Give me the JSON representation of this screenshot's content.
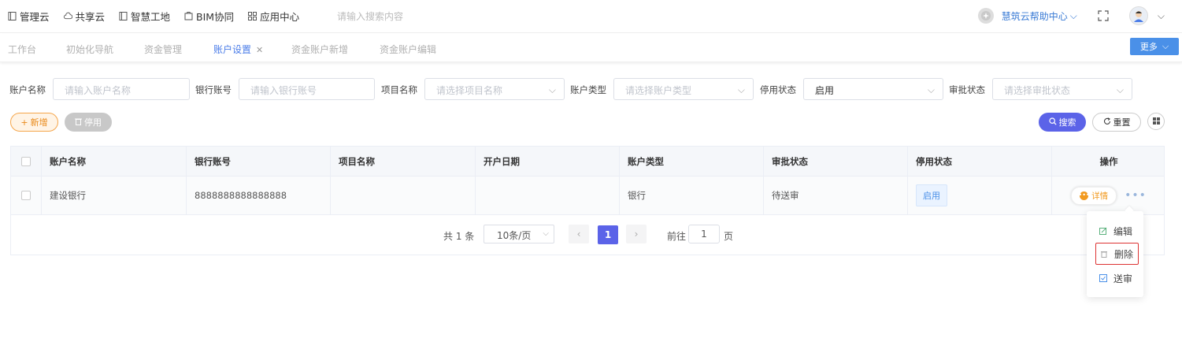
{
  "topnav": {
    "items": [
      {
        "label": "管理云",
        "icon": "book-icon"
      },
      {
        "label": "共享云",
        "icon": "cloud-icon"
      },
      {
        "label": "智慧工地",
        "icon": "book-icon"
      },
      {
        "label": "BIM协同",
        "icon": "box-icon"
      },
      {
        "label": "应用中心",
        "icon": "grid-icon"
      }
    ],
    "search_placeholder": "请输入搜索内容",
    "help_label": "慧筑云帮助中心"
  },
  "tabs": {
    "items": [
      "工作台",
      "初始化导航",
      "资金管理",
      "账户设置",
      "资金账户新增",
      "资金账户编辑"
    ],
    "active": "账户设置",
    "more_label": "更多"
  },
  "filters": {
    "account_name": {
      "label": "账户名称",
      "placeholder": "请输入账户名称"
    },
    "bank_account": {
      "label": "银行账号",
      "placeholder": "请输入银行账号"
    },
    "project_name": {
      "label": "项目名称",
      "placeholder": "请选择项目名称"
    },
    "account_type": {
      "label": "账户类型",
      "placeholder": "请选择账户类型"
    },
    "disable_status": {
      "label": "停用状态",
      "value": "启用"
    },
    "approval_status": {
      "label": "审批状态",
      "placeholder": "请选择审批状态"
    }
  },
  "actions": {
    "add_label": "新增",
    "disable_label": "停用",
    "search_label": "搜索",
    "reset_label": "重置"
  },
  "table": {
    "columns": [
      "账户名称",
      "银行账号",
      "项目名称",
      "开户日期",
      "账户类型",
      "审批状态",
      "停用状态",
      "操作"
    ],
    "rows": [
      {
        "account_name": "建设银行",
        "bank_account": "8888888888888888",
        "project_name": "",
        "open_date": "",
        "account_type": "银行",
        "approval_status": "待送审",
        "disable_status": "启用",
        "detail_label": "详情"
      }
    ]
  },
  "pagination": {
    "total": "共 1 条",
    "page_size": "10条/页",
    "current": "1",
    "goto_label": "前往",
    "goto_value": "1",
    "page_suffix": "页"
  },
  "row_menu": {
    "items": [
      {
        "label": "编辑",
        "icon": "edit-icon"
      },
      {
        "label": "删除",
        "icon": "trash-icon"
      },
      {
        "label": "送审",
        "icon": "submit-icon"
      }
    ]
  },
  "colors": {
    "primary": "#5b63e8",
    "accent_orange": "#f29a1f",
    "link_blue": "#4a90e8"
  }
}
